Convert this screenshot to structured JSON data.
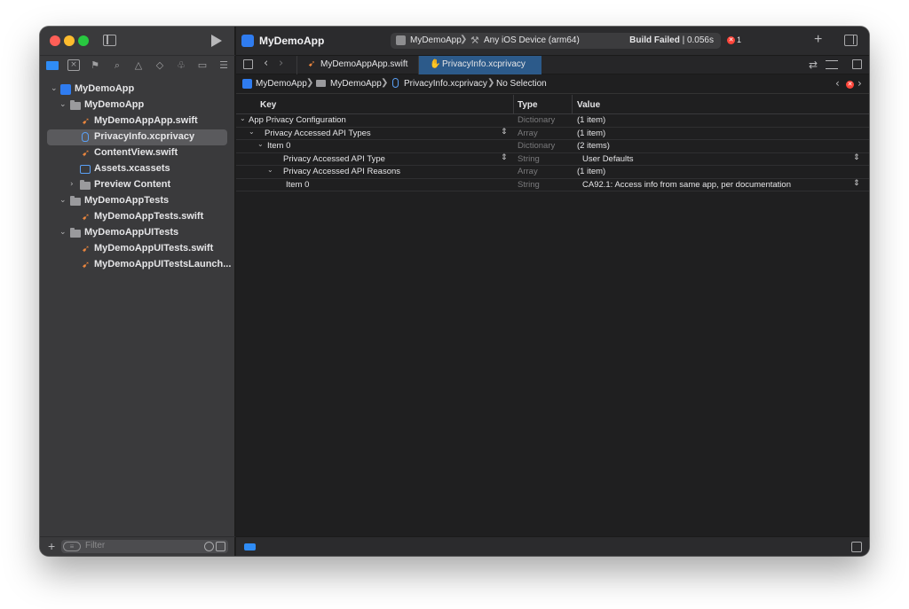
{
  "window": {
    "title": "MyDemoApp"
  },
  "toolbar": {
    "scheme": "MyDemoApp",
    "separator": "❯",
    "device": "Any iOS Device (arm64)",
    "build_status_bold": "Build Failed",
    "build_status_rest": " | 0.056s",
    "error_count": "1"
  },
  "sidebar": {
    "items": [
      {
        "label": "MyDemoApp",
        "kind": "project",
        "level": 0,
        "expanded": true
      },
      {
        "label": "MyDemoApp",
        "kind": "folder",
        "level": 1,
        "expanded": true
      },
      {
        "label": "MyDemoAppApp.swift",
        "kind": "swift",
        "level": 2
      },
      {
        "label": "PrivacyInfo.xcprivacy",
        "kind": "privacy",
        "level": 2,
        "selected": true
      },
      {
        "label": "ContentView.swift",
        "kind": "swift",
        "level": 2
      },
      {
        "label": "Assets.xcassets",
        "kind": "assets",
        "level": 2
      },
      {
        "label": "Preview Content",
        "kind": "folder",
        "level": 2,
        "expanded": false
      },
      {
        "label": "MyDemoAppTests",
        "kind": "folder",
        "level": 1,
        "expanded": true
      },
      {
        "label": "MyDemoAppTests.swift",
        "kind": "swift",
        "level": 2
      },
      {
        "label": "MyDemoAppUITests",
        "kind": "folder",
        "level": 1,
        "expanded": true
      },
      {
        "label": "MyDemoAppUITests.swift",
        "kind": "swift",
        "level": 2
      },
      {
        "label": "MyDemoAppUITestsLaunch...",
        "kind": "swift",
        "level": 2
      }
    ],
    "filter_placeholder": "Filter"
  },
  "tabs": [
    {
      "label": "MyDemoAppApp.swift",
      "active": false
    },
    {
      "label": "PrivacyInfo.xcprivacy",
      "active": true
    }
  ],
  "breadcrumb": {
    "items": [
      "MyDemoApp",
      "MyDemoApp",
      "PrivacyInfo.xcprivacy",
      "No Selection"
    ]
  },
  "plist": {
    "headers": {
      "key": "Key",
      "type": "Type",
      "value": "Value"
    },
    "rows": [
      {
        "key": "App Privacy Configuration",
        "type": "Dictionary",
        "value": "(1 item)"
      },
      {
        "key": "Privacy Accessed API Types",
        "type": "Array",
        "value": "(1 item)"
      },
      {
        "key": "Item 0",
        "type": "Dictionary",
        "value": "(2 items)"
      },
      {
        "key": "Privacy Accessed API Type",
        "type": "String",
        "value": "User Defaults"
      },
      {
        "key": "Privacy Accessed API Reasons",
        "type": "Array",
        "value": "(1 item)"
      },
      {
        "key": "Item 0",
        "type": "String",
        "value": "CA92.1: Access info from same app, per documentation"
      }
    ]
  },
  "colors": {
    "accent": "#2f8cf5",
    "swift_orange": "#f0883e",
    "error_red": "#ff453a"
  }
}
